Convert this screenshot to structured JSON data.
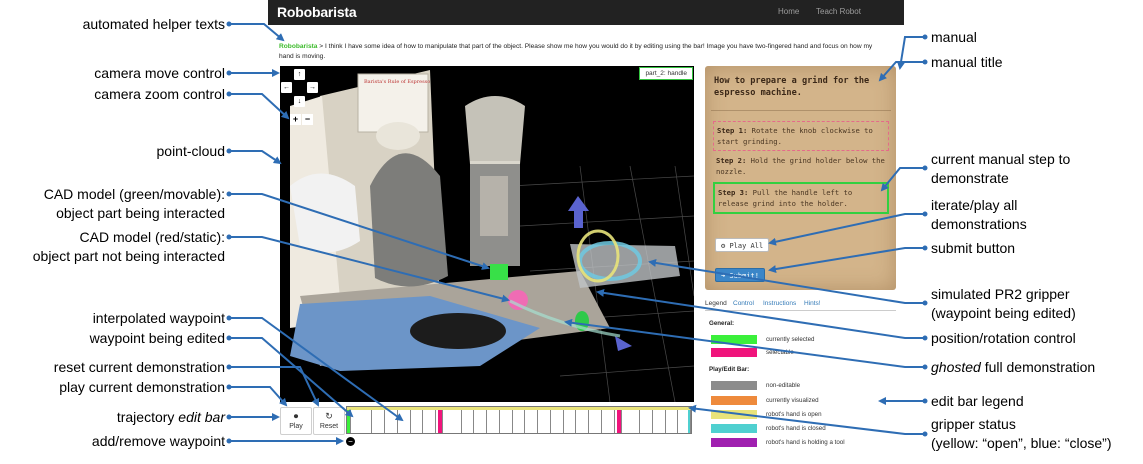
{
  "annotations_left": {
    "helper_texts": "automated helper texts",
    "camera_move": "camera move control",
    "camera_zoom": "camera zoom control",
    "point_cloud": "point-cloud",
    "cad_green_1": "CAD model (green/movable):",
    "cad_green_2": "object part being interacted",
    "cad_red_1": "CAD model (red/static):",
    "cad_red_2": "object part not being interacted",
    "interpolated": "interpolated waypoint",
    "waypoint_edit": "waypoint being edited",
    "reset": "reset current demonstration",
    "play": "play current demonstration",
    "trajectory_pre": "trajectory ",
    "trajectory_em": "edit bar",
    "add_remove": "add/remove waypoint"
  },
  "annotations_right": {
    "manual": "manual",
    "manual_title": "manual title",
    "current_step_1": "current manual step to",
    "current_step_2": "demonstrate",
    "iterate_1": "iterate/play all",
    "iterate_2": "demonstrations",
    "submit": "submit button",
    "gripper_1": "simulated PR2 gripper",
    "gripper_2": "(waypoint being edited)",
    "position": "position/rotation control",
    "ghosted_em": "ghosted",
    "ghosted_rest": " full demonstration",
    "edit_legend": "edit bar legend",
    "gripper_status_1": "gripper status",
    "gripper_status_2": "(yellow: “open”, blue: “close”)"
  },
  "app": {
    "brand": "Robobarista",
    "nav": [
      "Home",
      "Teach Robot"
    ],
    "helper_who": "Robobarista",
    "helper_sep": " > ",
    "helper_text": "I think I have some idea of how to manipulate that part of the object. Please show me how you would do it by editing using the bar! Image you have two-fingered hand and focus on how my hand is moving.",
    "part_label": "part_2: handle",
    "whiteboard_text": "Barista's Rule of Espresso"
  },
  "camera": {
    "up": "↑",
    "left": "←",
    "right": "→",
    "down": "↓",
    "zoom_in": "+",
    "zoom_out": "−"
  },
  "controls": {
    "play_icon": "⏺",
    "play_label": "Play",
    "reset_icon": "↻",
    "reset_label": "Reset",
    "add_remove_icon": "−"
  },
  "edit_bar": {
    "cells": 27,
    "highlight": [
      0
    ],
    "pink": [
      7,
      21
    ],
    "cyan_end": [
      26
    ],
    "colors": {
      "selected": "#3bf03b",
      "pink": "#f0147c",
      "cyan": "#4fd0d0",
      "open": "#e8e37a"
    }
  },
  "manual": {
    "title": "How to prepare a grind for the espresso machine.",
    "steps": [
      {
        "num": "Step 1:",
        "text": "Rotate the knob clockwise to start grinding."
      },
      {
        "num": "Step 2:",
        "text": "Hold the grind holder below the nozzle."
      },
      {
        "num": "Step 3:",
        "text": "Pull the handle left to release grind into the holder."
      }
    ],
    "play_all_icon": "⚙",
    "play_all": "Play All",
    "submit": "➜ Submit!"
  },
  "legend": {
    "tabs": [
      "Legend",
      "Control",
      "Instructions",
      "Hints!"
    ],
    "general_title": "General:",
    "general": [
      {
        "color": "#3bf03b",
        "label": "currently selected"
      },
      {
        "color": "#f0147c",
        "label": "selectable"
      }
    ],
    "playedit_title": "Play/Edit Bar:",
    "playedit": [
      {
        "color": "#8c8c8c",
        "label": "non-editable"
      },
      {
        "color": "#ee8a3c",
        "label": "currently visualized"
      },
      {
        "color": "#e8e37a",
        "label": "robot's hand is open"
      },
      {
        "color": "#4fd0d0",
        "label": "robot's hand is closed"
      },
      {
        "color": "#a020b0",
        "label": "robot's hand is holding a tool"
      }
    ]
  },
  "colors": {
    "arrow": "#2e6db4",
    "navbar": "#222222",
    "manual_bg": "#d3b48a",
    "brand_green": "#3dbb2c"
  }
}
